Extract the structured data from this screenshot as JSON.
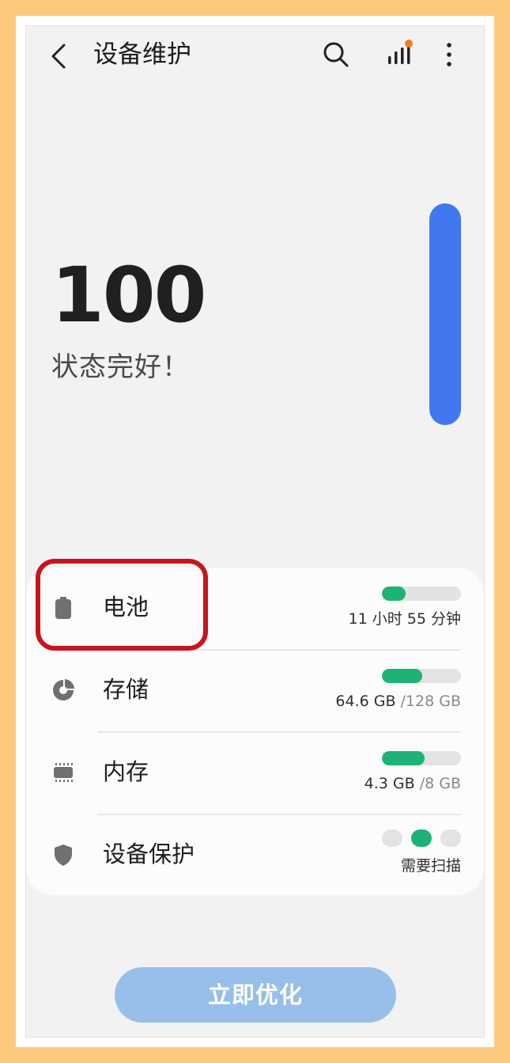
{
  "header": {
    "title": "设备维护",
    "icons": [
      "back-icon",
      "search-icon",
      "stats-icon",
      "more-icon"
    ]
  },
  "summary": {
    "score": "100",
    "status": "状态完好！",
    "score_level_percent": 100
  },
  "items": [
    {
      "label": "电池",
      "icon": "battery-icon",
      "value": "11 小时 55 分钟",
      "value_muted": "",
      "fill_fraction": 0.3
    },
    {
      "label": "存储",
      "icon": "storage-icon",
      "value": "64.6 GB ",
      "value_muted": "/128 GB",
      "fill_fraction": 0.505
    },
    {
      "label": "内存",
      "icon": "memory-icon",
      "value": "4.3 GB ",
      "value_muted": "/8 GB",
      "fill_fraction": 0.54
    },
    {
      "label": "设备保护",
      "icon": "shield-icon",
      "value": "需要扫描",
      "value_muted": "",
      "dots_active_index": 1
    }
  ],
  "optimize_button": {
    "label": "立即优化"
  },
  "colors": {
    "accent_blue": "#4178f0",
    "bar_green": "#1fb275",
    "highlight_red": "#c8141e",
    "button_disabled": "#97bfe9"
  }
}
